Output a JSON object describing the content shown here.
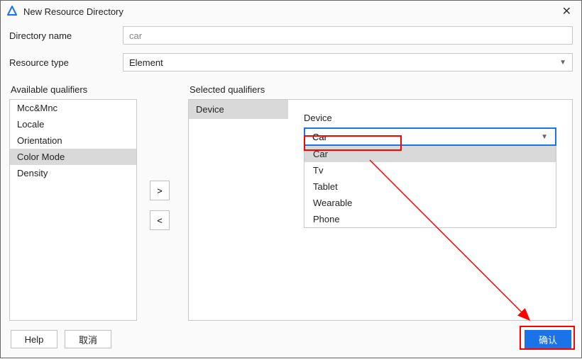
{
  "title": "New Resource Directory",
  "labels": {
    "directory_name": "Directory name",
    "resource_type": "Resource type",
    "available": "Available qualifiers",
    "selected": "Selected qualifiers",
    "device": "Device"
  },
  "fields": {
    "directory_name_value": "car",
    "resource_type_value": "Element"
  },
  "available_qualifiers": [
    {
      "label": "Mcc&Mnc",
      "selected": false
    },
    {
      "label": "Locale",
      "selected": false
    },
    {
      "label": "Orientation",
      "selected": false
    },
    {
      "label": "Color Mode",
      "selected": true
    },
    {
      "label": "Density",
      "selected": false
    }
  ],
  "transfer_buttons": {
    "add": ">",
    "remove": "<"
  },
  "selected_qualifiers": [
    {
      "label": "Device"
    }
  ],
  "device_combo": {
    "value": "Car",
    "options": [
      {
        "label": "Car",
        "active": true
      },
      {
        "label": "Tv",
        "active": false
      },
      {
        "label": "Tablet",
        "active": false
      },
      {
        "label": "Wearable",
        "active": false
      },
      {
        "label": "Phone",
        "active": false
      }
    ]
  },
  "buttons": {
    "help": "Help",
    "cancel": "取消",
    "ok": "确认"
  },
  "colors": {
    "accent": "#1a73e8",
    "highlight": "#ff0000"
  }
}
